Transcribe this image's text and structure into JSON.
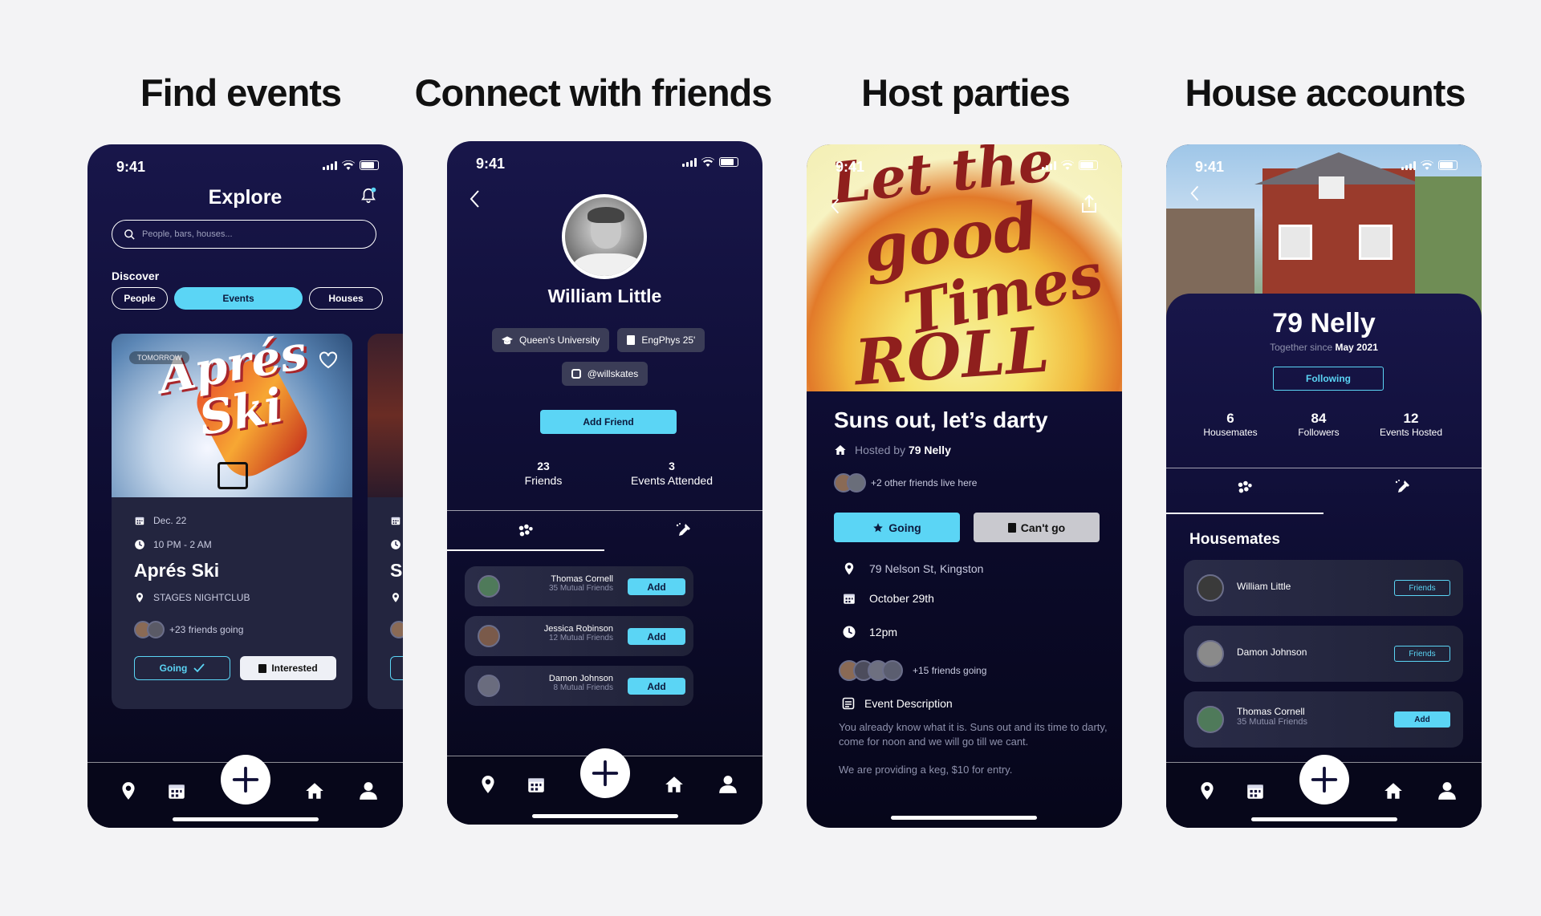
{
  "headlines": [
    "Find events",
    "Connect with friends",
    "Host parties",
    "House accounts"
  ],
  "status_time": "9:41",
  "explore": {
    "title": "Explore",
    "search_placeholder": "People, bars, houses...",
    "discover_label": "Discover",
    "filters": [
      "People",
      "Events",
      "Houses"
    ],
    "card": {
      "badge": "TOMORROW",
      "poster_text": "Aprés Ski",
      "date": "Dec. 22",
      "time": "10 PM - 2 AM",
      "title": "Aprés Ski",
      "venue": "STAGES NIGHTCLUB",
      "friends": "+23 friends going",
      "going": "Going",
      "interested": "Interested"
    },
    "peek_letter": "S"
  },
  "profile": {
    "name": "William Little",
    "chips": [
      "Queen's University",
      "EngPhys 25'",
      "@willskates"
    ],
    "add_friend": "Add Friend",
    "stats": [
      {
        "value": "23",
        "label": "Friends"
      },
      {
        "value": "3",
        "label": "Events Attended"
      }
    ],
    "friends": [
      {
        "name": "Thomas Cornell",
        "mutual": "35 Mutual Friends",
        "action": "Add"
      },
      {
        "name": "Jessica Robinson",
        "mutual": "12 Mutual Friends",
        "action": "Add"
      },
      {
        "name": "Damon Johnson",
        "mutual": "8 Mutual Friends",
        "action": "Add"
      }
    ]
  },
  "party": {
    "poster_words": [
      "Let the",
      "good",
      "Times",
      "ROLL"
    ],
    "title": "Suns out, let’s darty",
    "hosted_prefix": "Hosted by ",
    "hosted_by": "79 Nelly",
    "live_here": "+2 other friends live here",
    "going": "Going",
    "cant_go": "Can't go",
    "address": "79 Nelson St, Kingston",
    "date": "October 29th",
    "time": "12pm",
    "friends_going": "+15 friends going",
    "desc_label": "Event Description",
    "desc_1": "You already know what it is. Suns out and its time to darty, come for noon and we will go till we cant.",
    "desc_2": "We are providing a keg, $10 for entry."
  },
  "house": {
    "name": "79 Nelly",
    "together_prefix": "Together since ",
    "together_since": "May 2021",
    "following": "Following",
    "stats": [
      {
        "value": "6",
        "label": "Housemates"
      },
      {
        "value": "84",
        "label": "Followers"
      },
      {
        "value": "12",
        "label": "Events Hosted"
      }
    ],
    "section": "Housemates",
    "members": [
      {
        "name": "William Little",
        "sub": "",
        "action": "Friends"
      },
      {
        "name": "Damon Johnson",
        "sub": "",
        "action": "Friends"
      },
      {
        "name": "Thomas Cornell",
        "sub": "35 Mutual Friends",
        "action": "Add"
      }
    ]
  },
  "colors": {
    "accent": "#5bd5f5",
    "bg_top": "#18164a",
    "bg_bottom": "#07071a"
  }
}
